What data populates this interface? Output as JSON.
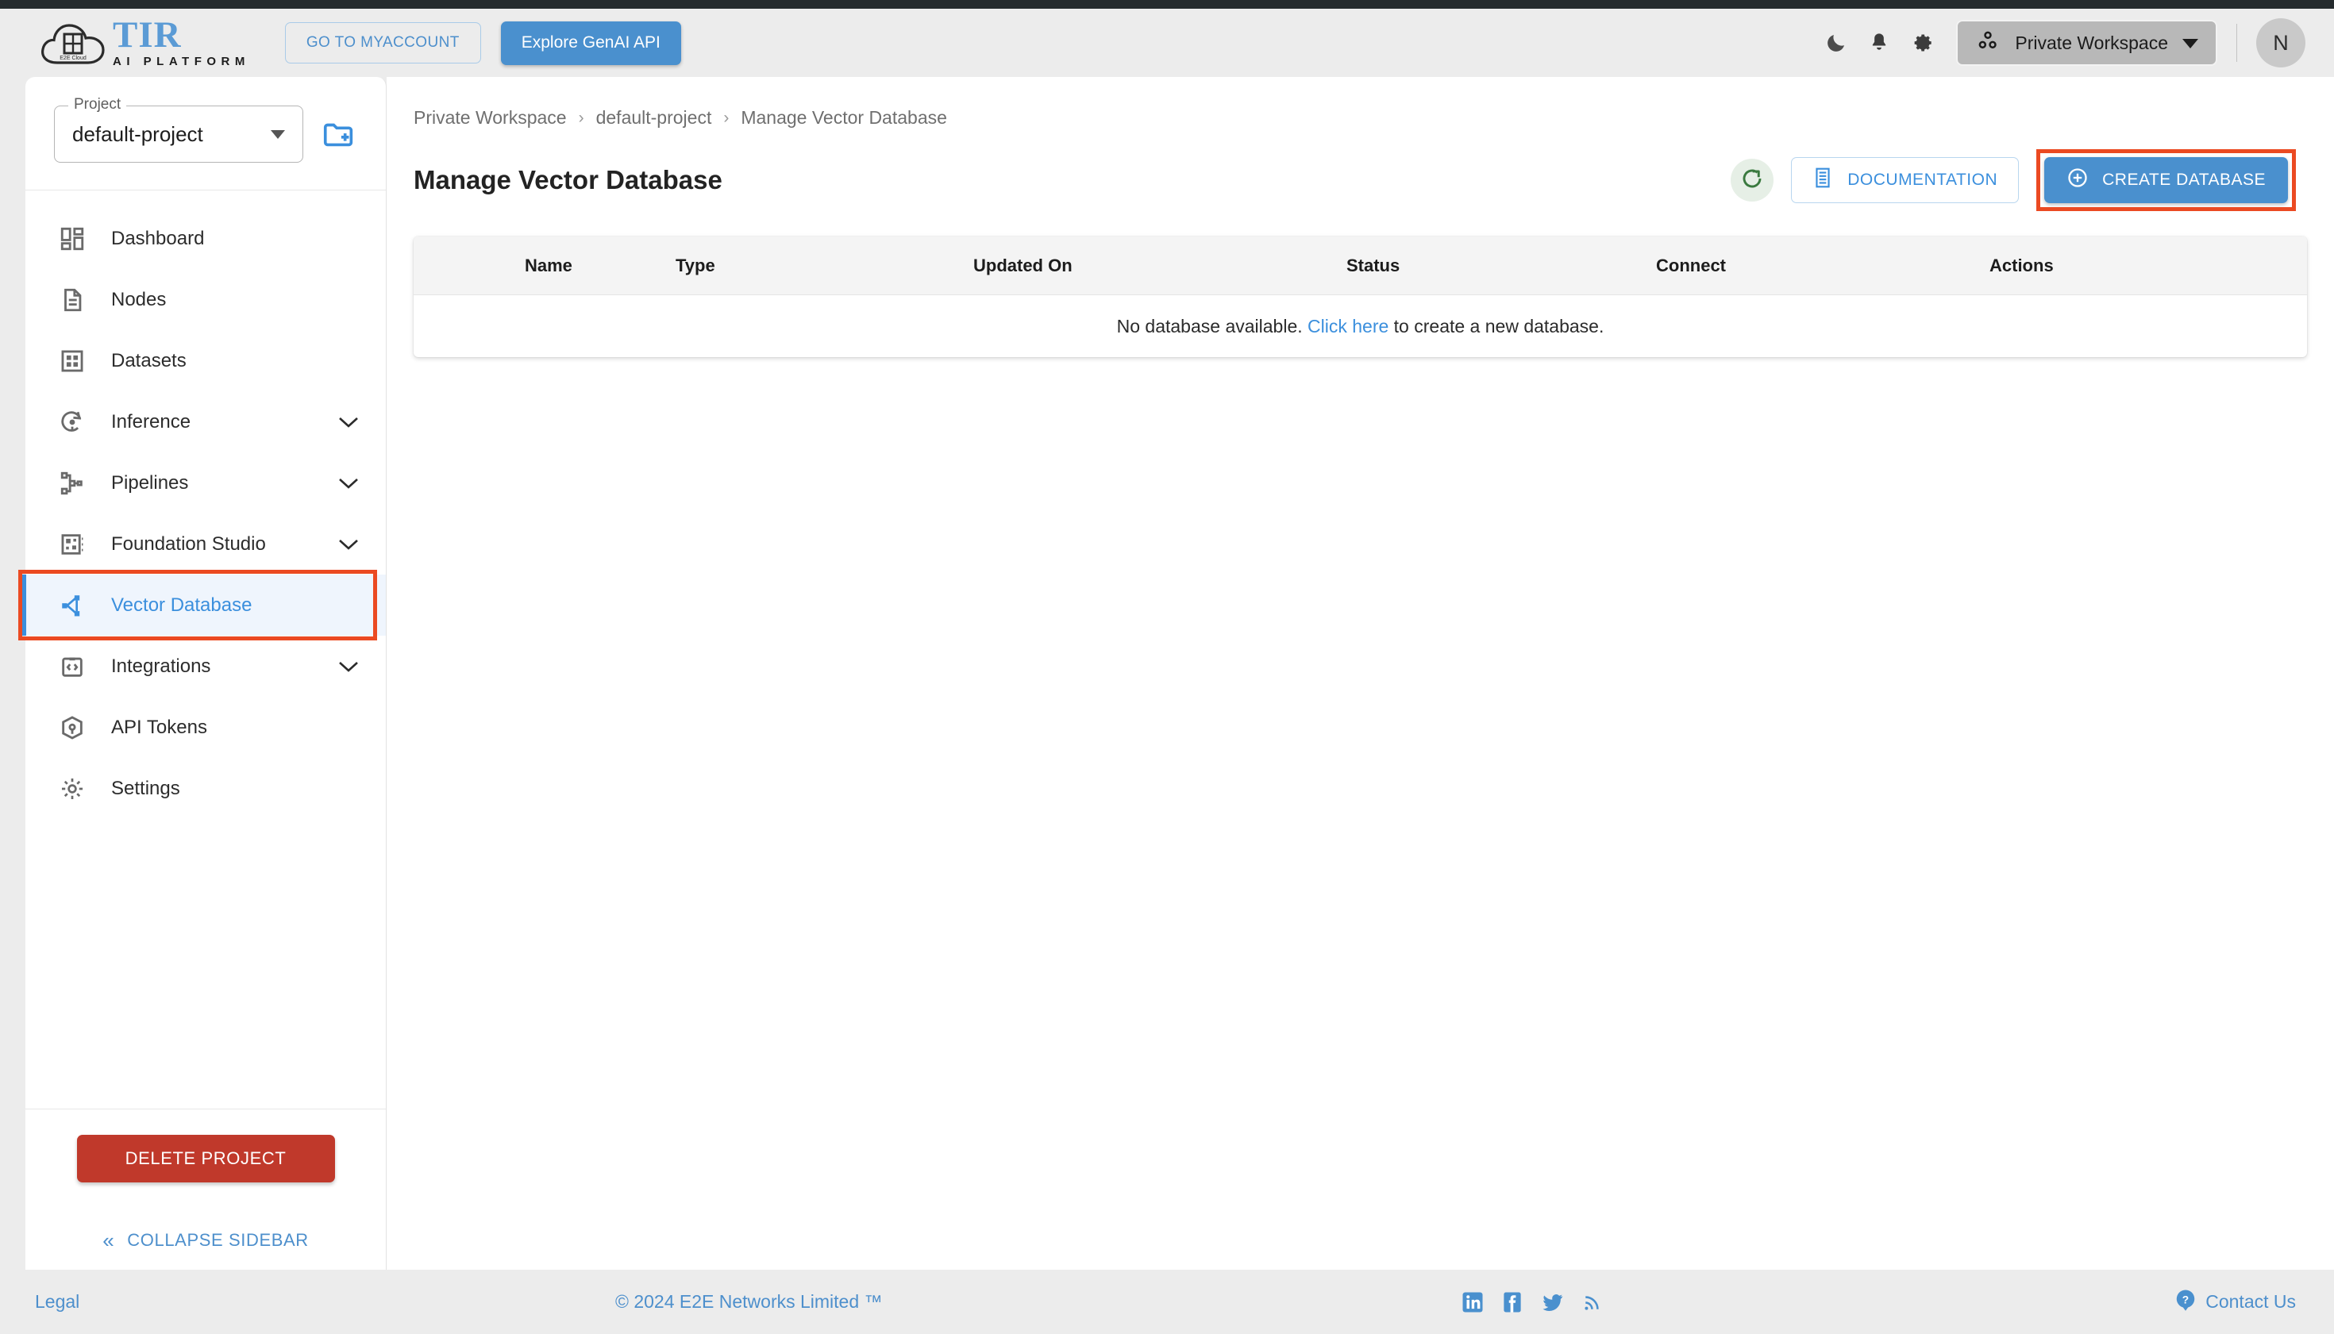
{
  "colors": {
    "accent_blue": "#4a90ce",
    "link_blue": "#3b8fdd",
    "annotation_red": "#eb4a22",
    "danger_red": "#c0392b",
    "refresh_green": "#3a7a3f",
    "page_bg": "#ececec",
    "top_strip": "#252b2e",
    "active_nav_bg": "#eff5fd"
  },
  "header": {
    "logo": {
      "brand": "TIR",
      "subtitle": "AI PLATFORM",
      "cloud_badge": "E2E Cloud",
      "icon": "cloud-logo-icon"
    },
    "myaccount_label": "GO TO MYACCOUNT",
    "genai_label": "Explore GenAI API",
    "icons": [
      "dark-mode-moon-icon",
      "notifications-bell-icon",
      "settings-gear-icon"
    ],
    "workspace": {
      "label": "Private Workspace",
      "icon": "workspace-group-icon"
    },
    "avatar_initial": "N"
  },
  "sidebar": {
    "project": {
      "label": "Project",
      "value": "default-project",
      "new_project_icon": "new-folder-icon"
    },
    "items": [
      {
        "label": "Dashboard",
        "icon": "dashboard-grid-icon",
        "expandable": false,
        "active": false
      },
      {
        "label": "Nodes",
        "icon": "document-lines-icon",
        "expandable": false,
        "active": false
      },
      {
        "label": "Datasets",
        "icon": "grid-square-icon",
        "expandable": false,
        "active": false
      },
      {
        "label": "Inference",
        "icon": "inference-refresh-bulb-icon",
        "expandable": true,
        "active": false
      },
      {
        "label": "Pipelines",
        "icon": "pipeline-branch-icon",
        "expandable": true,
        "active": false
      },
      {
        "label": "Foundation Studio",
        "icon": "chip-panel-icon",
        "expandable": true,
        "active": false
      },
      {
        "label": "Vector Database",
        "icon": "vector-nodes-icon",
        "expandable": false,
        "active": true
      },
      {
        "label": "Integrations",
        "icon": "code-brackets-icon",
        "expandable": true,
        "active": false
      },
      {
        "label": "API Tokens",
        "icon": "cube-token-icon",
        "expandable": false,
        "active": false
      },
      {
        "label": "Settings",
        "icon": "settings-gear-icon",
        "expandable": false,
        "active": false
      }
    ],
    "delete_project_label": "DELETE PROJECT",
    "collapse_label": "COLLAPSE SIDEBAR",
    "collapse_icon": "chevron-double-left-icon"
  },
  "main": {
    "breadcrumb": [
      "Private Workspace",
      "default-project",
      "Manage Vector Database"
    ],
    "breadcrumb_separator": "›",
    "page_title": "Manage Vector Database",
    "refresh_icon": "refresh-icon",
    "documentation_label": "DOCUMENTATION",
    "documentation_icon": "document-icon",
    "create_label": "CREATE DATABASE",
    "create_icon": "plus-circle-icon",
    "table": {
      "columns": [
        "Name",
        "Type",
        "Updated On",
        "Status",
        "Connect",
        "Actions"
      ],
      "rows": [],
      "empty_prefix": "No database available. ",
      "empty_link": "Click here",
      "empty_suffix": " to create a new database."
    }
  },
  "footer": {
    "legal": "Legal",
    "copyright": "© 2024 E2E Networks Limited ™",
    "social": [
      "linkedin-icon",
      "facebook-icon",
      "twitter-icon",
      "rss-icon"
    ],
    "contact_label": "Contact Us",
    "contact_icon": "question-bubble-icon"
  }
}
